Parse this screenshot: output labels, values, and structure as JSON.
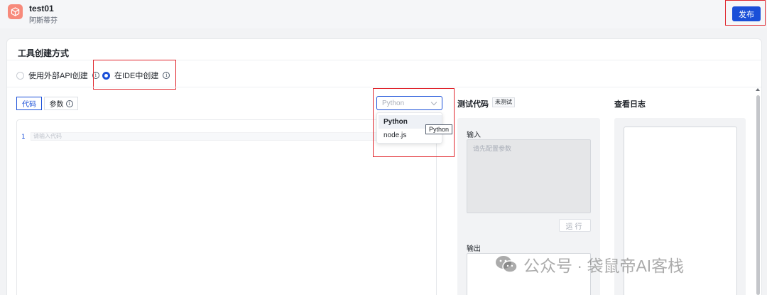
{
  "header": {
    "title": "test01",
    "subtitle": "阿斯蒂芬",
    "publish_label": "发布"
  },
  "section": {
    "title": "工具创建方式"
  },
  "creation_modes": [
    {
      "label": "使用外部API创建",
      "selected": false
    },
    {
      "label": "在IDE中创建",
      "selected": true
    }
  ],
  "tabs": [
    {
      "label": "代码",
      "active": true
    },
    {
      "label": "参数",
      "active": false
    }
  ],
  "editor": {
    "line_number": "1",
    "placeholder": "请输入代码"
  },
  "language_select": {
    "placeholder": "Python",
    "options": [
      "Python",
      "node.js"
    ],
    "highlighted": "Python",
    "tooltip": "Python"
  },
  "test_panel": {
    "title": "测试代码",
    "status_badge": "未测试",
    "input_label": "输入",
    "input_placeholder": "请先配置参数",
    "run_label": "运行",
    "output_label": "输出"
  },
  "log_panel": {
    "title": "查看日志"
  },
  "watermark": {
    "text": "公众号 · 袋鼠帝AI客栈"
  },
  "colors": {
    "primary": "#1a4fd8",
    "highlight_box": "#e0262d",
    "app_icon": "#f78a7b"
  },
  "icons": {
    "app": "cube-icon",
    "info": "info-icon",
    "chevron": "chevron-down-icon",
    "watermark": "wechat-icon"
  }
}
